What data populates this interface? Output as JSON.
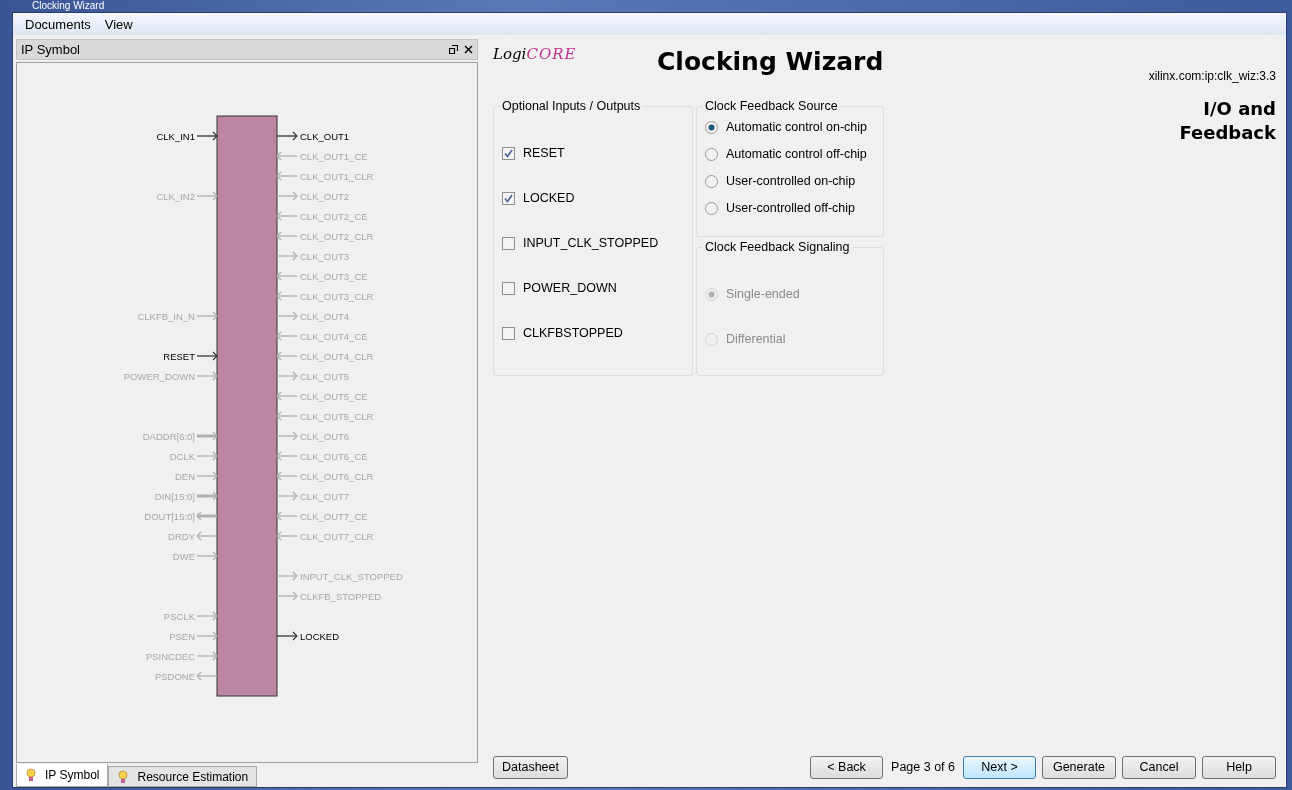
{
  "window": {
    "title": "Clocking Wizard"
  },
  "menu": [
    {
      "label": "Documents"
    },
    {
      "label": "View"
    }
  ],
  "left_panel": {
    "title": "IP Symbol",
    "left_pins": [
      {
        "name": "CLK_IN1",
        "kind": "in",
        "bus": false,
        "enabled": true
      },
      {
        "name": "CLK_IN2",
        "kind": "in",
        "bus": false,
        "enabled": false
      },
      {
        "name": "CLKFB_IN_N",
        "kind": "in",
        "bus": false,
        "enabled": false
      },
      {
        "name": "RESET",
        "kind": "in",
        "bus": false,
        "enabled": true
      },
      {
        "name": "POWER_DOWN",
        "kind": "in",
        "bus": false,
        "enabled": false
      },
      {
        "name": "DADDR[6:0]",
        "kind": "in",
        "bus": true,
        "enabled": false
      },
      {
        "name": "DCLK",
        "kind": "in",
        "bus": false,
        "enabled": false
      },
      {
        "name": "DEN",
        "kind": "in",
        "bus": false,
        "enabled": false
      },
      {
        "name": "DIN[15:0]",
        "kind": "in",
        "bus": true,
        "enabled": false
      },
      {
        "name": "DOUT[15:0]",
        "kind": "out",
        "bus": true,
        "enabled": false
      },
      {
        "name": "DRDY",
        "kind": "out",
        "bus": false,
        "enabled": false
      },
      {
        "name": "DWE",
        "kind": "in",
        "bus": false,
        "enabled": false
      },
      {
        "name": "PSCLK",
        "kind": "in",
        "bus": false,
        "enabled": false
      },
      {
        "name": "PSEN",
        "kind": "in",
        "bus": false,
        "enabled": false
      },
      {
        "name": "PSINCDEC",
        "kind": "in",
        "bus": false,
        "enabled": false
      },
      {
        "name": "PSDONE",
        "kind": "out",
        "bus": false,
        "enabled": false
      }
    ],
    "right_pins": [
      {
        "name": "CLK_OUT1",
        "kind": "out",
        "bus": false,
        "enabled": true
      },
      {
        "name": "CLK_OUT1_CE",
        "kind": "in",
        "bus": false,
        "enabled": false
      },
      {
        "name": "CLK_OUT1_CLR",
        "kind": "in",
        "bus": false,
        "enabled": false
      },
      {
        "name": "CLK_OUT2",
        "kind": "out",
        "bus": false,
        "enabled": false
      },
      {
        "name": "CLK_OUT2_CE",
        "kind": "in",
        "bus": false,
        "enabled": false
      },
      {
        "name": "CLK_OUT2_CLR",
        "kind": "in",
        "bus": false,
        "enabled": false
      },
      {
        "name": "CLK_OUT3",
        "kind": "out",
        "bus": false,
        "enabled": false
      },
      {
        "name": "CLK_OUT3_CE",
        "kind": "in",
        "bus": false,
        "enabled": false
      },
      {
        "name": "CLK_OUT3_CLR",
        "kind": "in",
        "bus": false,
        "enabled": false
      },
      {
        "name": "CLK_OUT4",
        "kind": "out",
        "bus": false,
        "enabled": false
      },
      {
        "name": "CLK_OUT4_CE",
        "kind": "in",
        "bus": false,
        "enabled": false
      },
      {
        "name": "CLK_OUT4_CLR",
        "kind": "in",
        "bus": false,
        "enabled": false
      },
      {
        "name": "CLK_OUT5",
        "kind": "out",
        "bus": false,
        "enabled": false
      },
      {
        "name": "CLK_OUT5_CE",
        "kind": "in",
        "bus": false,
        "enabled": false
      },
      {
        "name": "CLK_OUT5_CLR",
        "kind": "in",
        "bus": false,
        "enabled": false
      },
      {
        "name": "CLK_OUT6",
        "kind": "out",
        "bus": false,
        "enabled": false
      },
      {
        "name": "CLK_OUT6_CE",
        "kind": "in",
        "bus": false,
        "enabled": false
      },
      {
        "name": "CLK_OUT6_CLR",
        "kind": "in",
        "bus": false,
        "enabled": false
      },
      {
        "name": "CLK_OUT7",
        "kind": "out",
        "bus": false,
        "enabled": false
      },
      {
        "name": "CLK_OUT7_CE",
        "kind": "in",
        "bus": false,
        "enabled": false
      },
      {
        "name": "CLK_OUT7_CLR",
        "kind": "in",
        "bus": false,
        "enabled": false
      },
      {
        "name": "INPUT_CLK_STOPPED",
        "kind": "out",
        "bus": false,
        "enabled": false
      },
      {
        "name": "CLKFB_STOPPED",
        "kind": "out",
        "bus": false,
        "enabled": false
      },
      {
        "name": "LOCKED",
        "kind": "out",
        "bus": false,
        "enabled": true
      }
    ],
    "tabs": [
      {
        "label": "IP Symbol",
        "selected": true
      },
      {
        "label": "Resource Estimation",
        "selected": false
      }
    ]
  },
  "header": {
    "logo_prefix": "Logi",
    "logo_suffix": "CORE",
    "title": "Clocking Wizard",
    "ip_id": "xilinx.com:ip:clk_wiz:3.3",
    "page_title": "I/O and Feedback"
  },
  "optional_io": {
    "title": "Optional Inputs / Outputs",
    "options": [
      {
        "label": "RESET",
        "checked": true
      },
      {
        "label": "LOCKED",
        "checked": true
      },
      {
        "label": "INPUT_CLK_STOPPED",
        "checked": false
      },
      {
        "label": "POWER_DOWN",
        "checked": false
      },
      {
        "label": "CLKFBSTOPPED",
        "checked": false
      }
    ]
  },
  "feedback_source": {
    "title": "Clock Feedback Source",
    "options": [
      {
        "label": "Automatic control on-chip",
        "selected": true,
        "disabled": false
      },
      {
        "label": "Automatic control off-chip",
        "selected": false,
        "disabled": false
      },
      {
        "label": "User-controlled on-chip",
        "selected": false,
        "disabled": false
      },
      {
        "label": "User-controlled off-chip",
        "selected": false,
        "disabled": false
      }
    ]
  },
  "feedback_signaling": {
    "title": "Clock Feedback Signaling",
    "options": [
      {
        "label": "Single-ended",
        "selected": true,
        "disabled": true
      },
      {
        "label": "Differential",
        "selected": false,
        "disabled": true
      }
    ]
  },
  "footer": {
    "datasheet": "Datasheet",
    "back": "< Back",
    "page": "Page 3 of 6",
    "next": "Next >",
    "generate": "Generate",
    "cancel": "Cancel",
    "help": "Help"
  }
}
